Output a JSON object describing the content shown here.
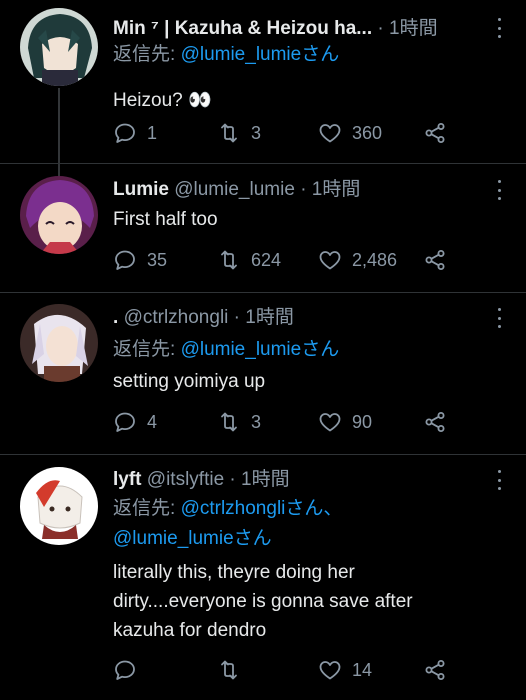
{
  "tweets": [
    {
      "name": "Min ⁷ | Kazuha & Heizou ha...",
      "handle": "",
      "time": "1時間",
      "reply_prefix": "返信先: ",
      "mentions": [
        "@lumie_lumieさん"
      ],
      "text": "Heizou? 👀",
      "replies": "1",
      "retweets": "3",
      "likes": "360"
    },
    {
      "name": "Lumie",
      "handle": "@lumie_lumie",
      "time": "1時間",
      "text": "First half too",
      "replies": "35",
      "retweets": "624",
      "likes": "2,486"
    },
    {
      "name": ".",
      "handle": "@ctrlzhongli",
      "time": "1時間",
      "reply_prefix": "返信先: ",
      "mentions": [
        "@lumie_lumieさん"
      ],
      "text": "setting yoimiya up",
      "replies": "4",
      "retweets": "3",
      "likes": "90"
    },
    {
      "name": "lyft",
      "handle": "@itslyftie",
      "time": "1時間",
      "reply_prefix": "返信先: ",
      "mentions": [
        "@ctrlzhongliさん、",
        "@lumie_lumieさん"
      ],
      "text_lines": [
        "literally this, theyre doing her",
        "dirty....everyone is gonna save after",
        "kazuha for dendro"
      ],
      "replies": "",
      "retweets": "",
      "likes": "14"
    }
  ],
  "separator": "·",
  "icons": [
    "reply-icon",
    "retweet-icon",
    "like-icon",
    "share-icon",
    "more-icon"
  ],
  "colors": {
    "background": "#000000",
    "text": "#e7e9ea",
    "secondary": "#8b98a5",
    "link": "#1d9bf0"
  }
}
